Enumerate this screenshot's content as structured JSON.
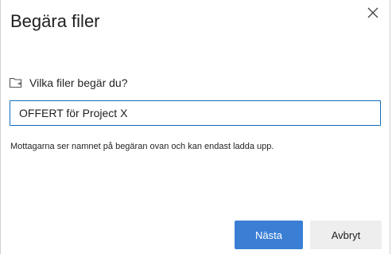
{
  "dialog": {
    "title": "Begära filer",
    "close_icon": "close-icon",
    "question": {
      "icon": "folder-request-icon",
      "label": "Vilka filer begär du?"
    },
    "input": {
      "value": "OFFERT för Project X",
      "placeholder": ""
    },
    "helper_text": "Mottagarna ser namnet på begäran ovan och kan endast ladda upp.",
    "buttons": {
      "next_label": "Nästa",
      "cancel_label": "Avbryt"
    },
    "colors": {
      "primary": "#3b7fd5",
      "input_border": "#0f6cbd",
      "secondary_bg": "#eeeeee"
    }
  }
}
